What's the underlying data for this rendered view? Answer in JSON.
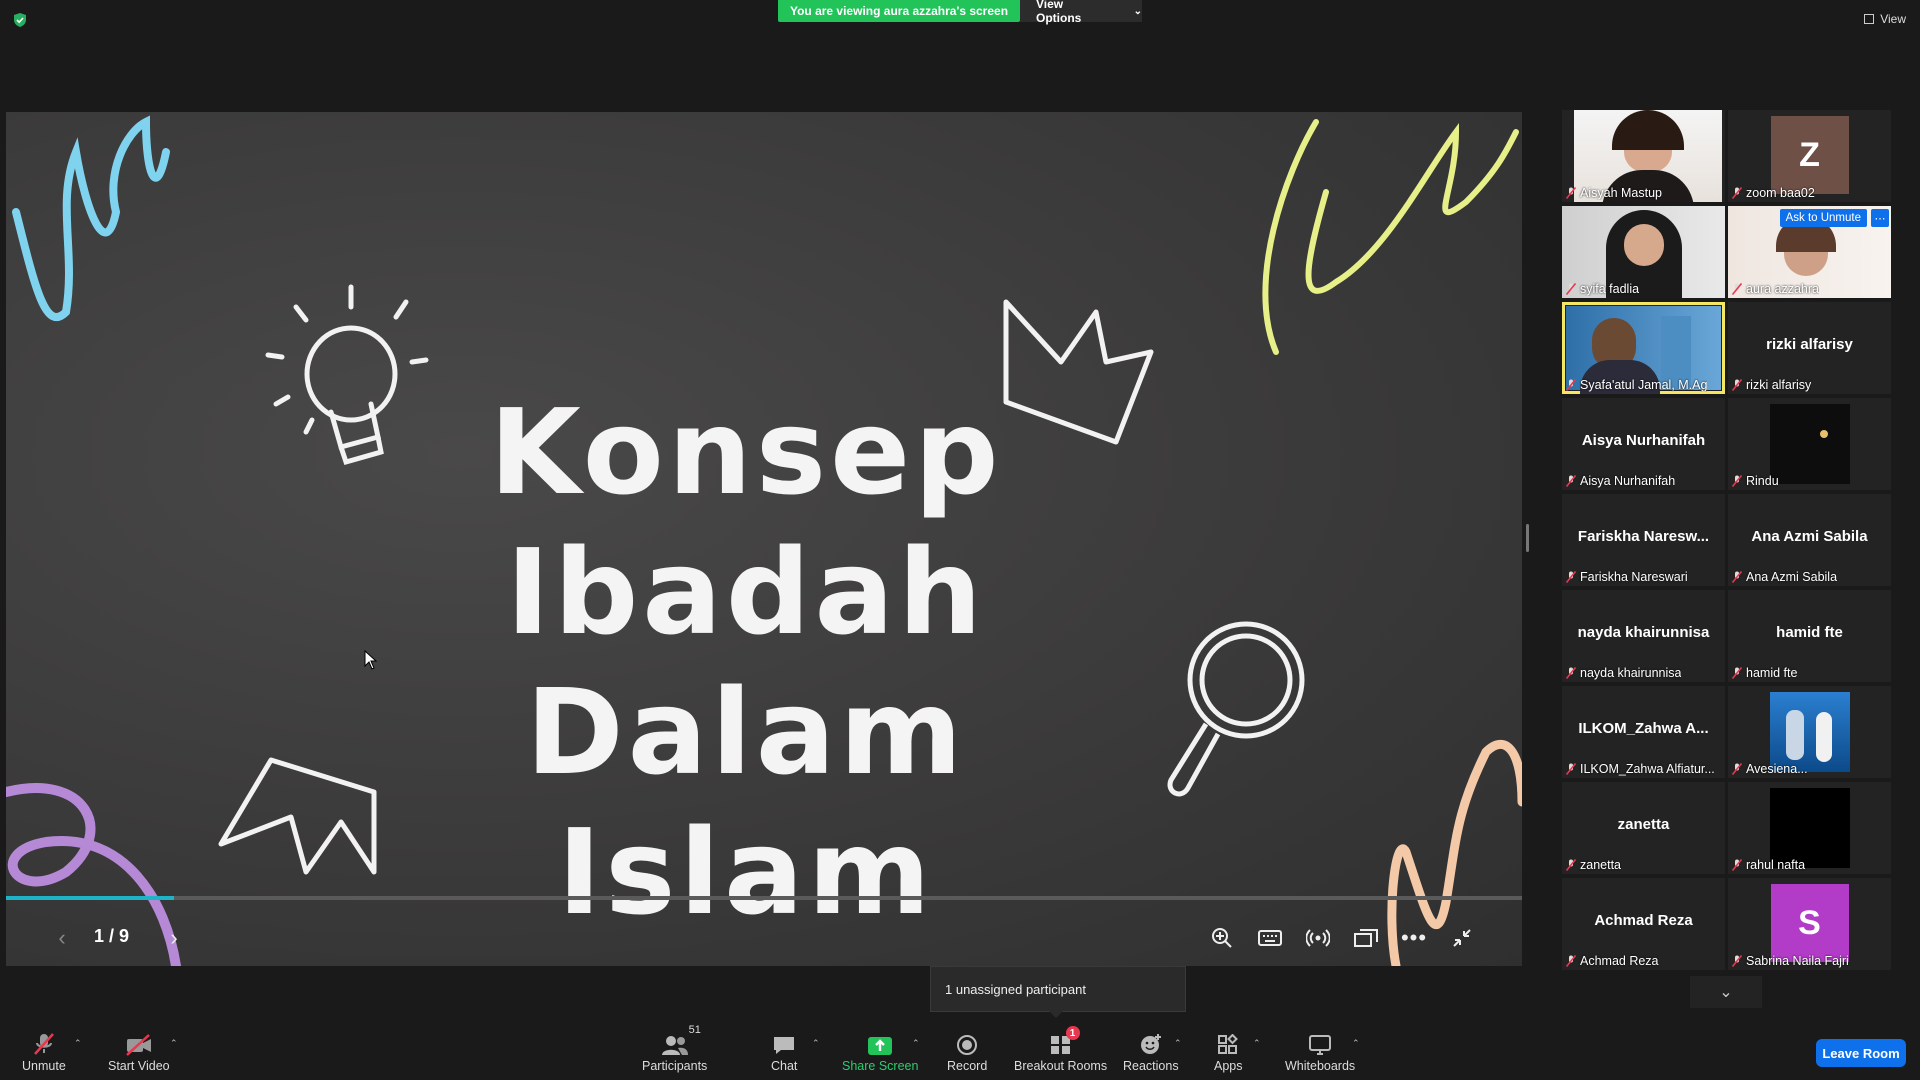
{
  "banner": {
    "viewing": "You are viewing aura azzahra's screen",
    "view_options": "View Options"
  },
  "top_right": {
    "view": "View"
  },
  "slide": {
    "title_lines": [
      "Konsep",
      "Ibadah",
      "Dalam Islam"
    ],
    "page": "1 / 9",
    "progress_fraction": 0.111
  },
  "gallery": {
    "tiles": [
      {
        "label": "Aisyah Mastup",
        "big": "",
        "kind": "video-girl"
      },
      {
        "label": "zoom baa02",
        "big": "",
        "kind": "avatar-z",
        "letter": "Z",
        "color": "#6f5047"
      },
      {
        "label": "syifa fadlia",
        "big": "",
        "kind": "video-hijab"
      },
      {
        "label": "aura azzahra",
        "big": "",
        "kind": "video-light",
        "ask": "Ask to Unmute"
      },
      {
        "label": "Syafa'atul Jamal, M.Ag",
        "big": "",
        "kind": "video-man",
        "active": true
      },
      {
        "label": "rizki alfarisy",
        "big": "rizki alfarisy",
        "kind": "name"
      },
      {
        "label": "Aisya Nurhanifah",
        "big": "Aisya Nurhanifah",
        "kind": "name"
      },
      {
        "label": "Rindu",
        "big": "",
        "kind": "dark-photo"
      },
      {
        "label": "Fariskha Nareswari",
        "big": "Fariskha Naresw...",
        "kind": "name"
      },
      {
        "label": "Ana Azmi Sabila",
        "big": "Ana Azmi Sabila",
        "kind": "name"
      },
      {
        "label": "nayda khairunnisa",
        "big": "nayda khairunnisa",
        "kind": "name"
      },
      {
        "label": "hamid fte",
        "big": "hamid fte",
        "kind": "name"
      },
      {
        "label": "ILKOM_Zahwa Alfiatur...",
        "big": "ILKOM_Zahwa A...",
        "kind": "name"
      },
      {
        "label": "Avesiena...",
        "big": "",
        "kind": "photo-blue"
      },
      {
        "label": "zanetta",
        "big": "zanetta",
        "kind": "name"
      },
      {
        "label": "rahul nafta",
        "big": "",
        "kind": "black"
      },
      {
        "label": "Achmad Reza",
        "big": "Achmad Reza",
        "kind": "name"
      },
      {
        "label": "Sabrina Naila Fajri",
        "big": "",
        "kind": "avatar-s",
        "letter": "S",
        "color": "#b23cc8"
      }
    ]
  },
  "unassigned": "1 unassigned participant",
  "toolbar": {
    "unmute": "Unmute",
    "start_video": "Start Video",
    "participants": "Participants",
    "participants_count": "51",
    "chat": "Chat",
    "share_screen": "Share Screen",
    "record": "Record",
    "breakout_rooms": "Breakout Rooms",
    "breakout_badge": "1",
    "reactions": "Reactions",
    "apps": "Apps",
    "whiteboards": "Whiteboards",
    "leave": "Leave Room"
  },
  "colors": {
    "share_green": "#22c45a",
    "leave_blue": "#0e71eb",
    "active_border": "#f5e663",
    "progress": "#1fb3c8"
  }
}
